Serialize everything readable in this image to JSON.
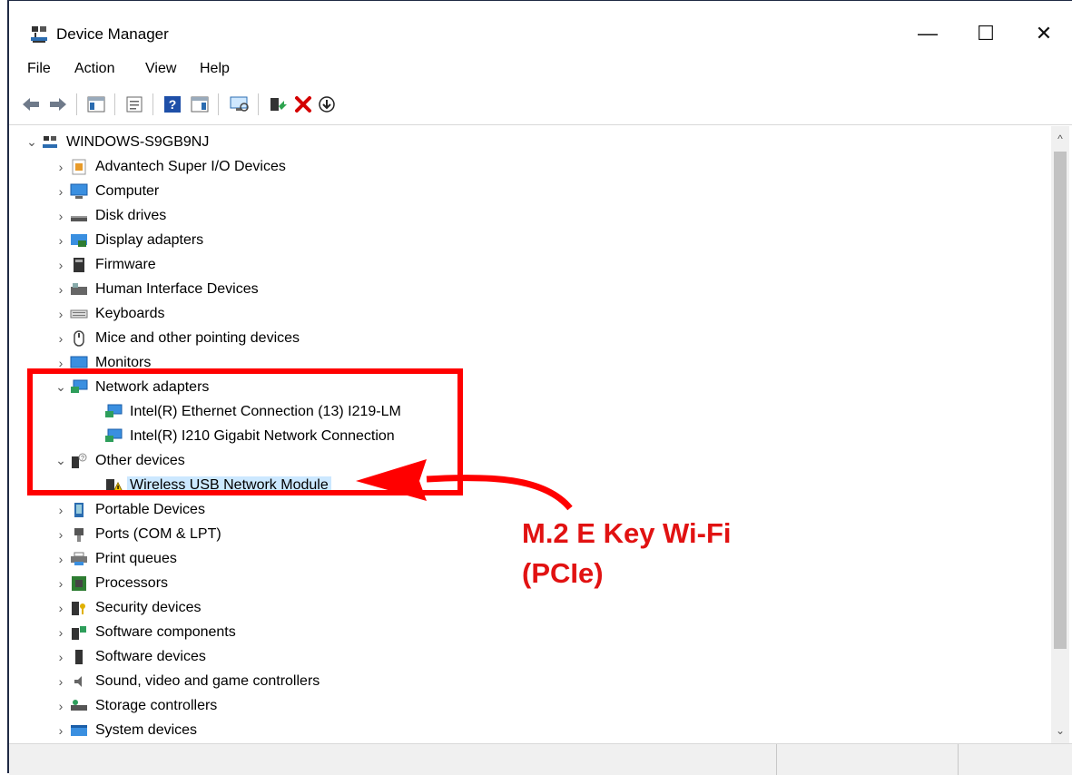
{
  "window": {
    "title": "Device Manager",
    "minimize_glyph": "—",
    "maximize_glyph": "☐",
    "close_glyph": "✕"
  },
  "menu": [
    "File",
    "Action",
    "View",
    "Help"
  ],
  "tree": {
    "root": "WINDOWS-S9GB9NJ",
    "items": [
      {
        "label": "Advantech Super I/O Devices",
        "icon": "chip-icon",
        "expanded": false
      },
      {
        "label": "Computer",
        "icon": "computer-icon",
        "expanded": false
      },
      {
        "label": "Disk drives",
        "icon": "disk-icon",
        "expanded": false
      },
      {
        "label": "Display adapters",
        "icon": "display-adapter-icon",
        "expanded": false
      },
      {
        "label": "Firmware",
        "icon": "firmware-icon",
        "expanded": false
      },
      {
        "label": "Human Interface Devices",
        "icon": "hid-icon",
        "expanded": false
      },
      {
        "label": "Keyboards",
        "icon": "keyboard-icon",
        "expanded": false
      },
      {
        "label": "Mice and other pointing devices",
        "icon": "mouse-icon",
        "expanded": false
      },
      {
        "label": "Monitors",
        "icon": "monitor-icon",
        "expanded": false
      },
      {
        "label": "Network adapters",
        "icon": "network-icon",
        "expanded": true,
        "children": [
          "Intel(R) Ethernet Connection (13) I219-LM",
          "Intel(R) I210 Gigabit Network Connection"
        ]
      },
      {
        "label": "Other devices",
        "icon": "other-devices-icon",
        "expanded": true,
        "children": [
          "Wireless USB Network Module"
        ]
      },
      {
        "label": "Portable Devices",
        "icon": "portable-icon",
        "expanded": false
      },
      {
        "label": "Ports (COM & LPT)",
        "icon": "port-icon",
        "expanded": false
      },
      {
        "label": "Print queues",
        "icon": "printer-icon",
        "expanded": false
      },
      {
        "label": "Processors",
        "icon": "processor-icon",
        "expanded": false
      },
      {
        "label": "Security devices",
        "icon": "security-icon",
        "expanded": false
      },
      {
        "label": "Software components",
        "icon": "software-component-icon",
        "expanded": false
      },
      {
        "label": "Software devices",
        "icon": "software-device-icon",
        "expanded": false
      },
      {
        "label": "Sound, video and game controllers",
        "icon": "sound-icon",
        "expanded": false
      },
      {
        "label": "Storage controllers",
        "icon": "storage-icon",
        "expanded": false
      },
      {
        "label": "System devices",
        "icon": "system-icon",
        "expanded": false
      }
    ],
    "selected": "Wireless USB Network Module"
  },
  "annotation": {
    "line1": "M.2 E Key Wi-Fi",
    "line2": "(PCIe)",
    "color": "#ff0000"
  }
}
